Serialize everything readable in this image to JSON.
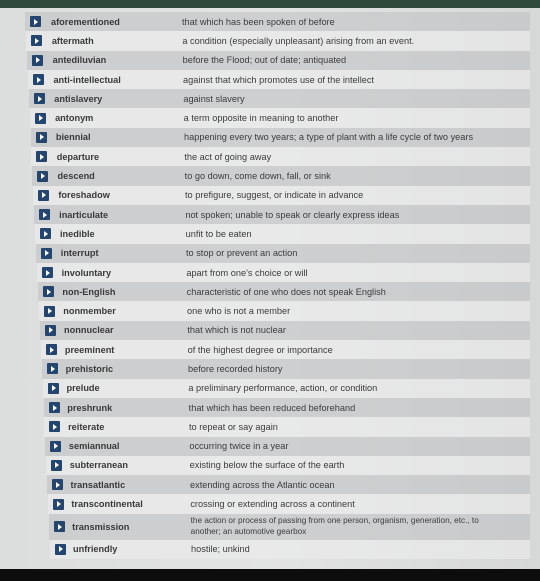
{
  "vocabulary": [
    {
      "term": "aforementioned",
      "definition": "that which has been spoken of before"
    },
    {
      "term": "aftermath",
      "definition": "a condition (especially unpleasant) arising from an event."
    },
    {
      "term": "antediluvian",
      "definition": "before the Flood; out of date; antiquated"
    },
    {
      "term": "anti-intellectual",
      "definition": "against that which promotes use of the intellect"
    },
    {
      "term": "antislavery",
      "definition": "against slavery"
    },
    {
      "term": "antonym",
      "definition": "a term opposite in meaning to another"
    },
    {
      "term": "biennial",
      "definition": "happening every two years; a type of plant with a life cycle of two years"
    },
    {
      "term": "departure",
      "definition": "the act of going away"
    },
    {
      "term": "descend",
      "definition": "to go down, come down, fall, or sink"
    },
    {
      "term": "foreshadow",
      "definition": "to prefigure, suggest, or indicate in advance"
    },
    {
      "term": "inarticulate",
      "definition": "not spoken; unable to speak or clearly express ideas"
    },
    {
      "term": "inedible",
      "definition": "unfit to be eaten"
    },
    {
      "term": "interrupt",
      "definition": "to stop or prevent an action"
    },
    {
      "term": "involuntary",
      "definition": "apart from one's choice or will"
    },
    {
      "term": "non-English",
      "definition": "characteristic of one who does not speak English"
    },
    {
      "term": "nonmember",
      "definition": "one who is not a member"
    },
    {
      "term": "nonnuclear",
      "definition": "that which is not nuclear"
    },
    {
      "term": "preeminent",
      "definition": "of the highest degree or importance"
    },
    {
      "term": "prehistoric",
      "definition": "before recorded history"
    },
    {
      "term": "prelude",
      "definition": "a preliminary performance, action, or condition"
    },
    {
      "term": "preshrunk",
      "definition": "that which has been reduced beforehand"
    },
    {
      "term": "reiterate",
      "definition": "to repeat or say again"
    },
    {
      "term": "semiannual",
      "definition": "occurring twice in a year"
    },
    {
      "term": "subterranean",
      "definition": "existing below the surface of the earth"
    },
    {
      "term": "transatlantic",
      "definition": "extending across the Atlantic ocean"
    },
    {
      "term": "transcontinental",
      "definition": "crossing or extending across a continent"
    },
    {
      "term": "transmission",
      "definition": "the action or process of passing from one person, organism, generation, etc., to another; an automotive gearbox"
    },
    {
      "term": "unfriendly",
      "definition": "hostile; unkind"
    }
  ],
  "icons": {
    "row_icon": "play-audio-icon"
  },
  "colors": {
    "play_icon_bg": "#24466e",
    "top_band": "#2f4a3a"
  }
}
